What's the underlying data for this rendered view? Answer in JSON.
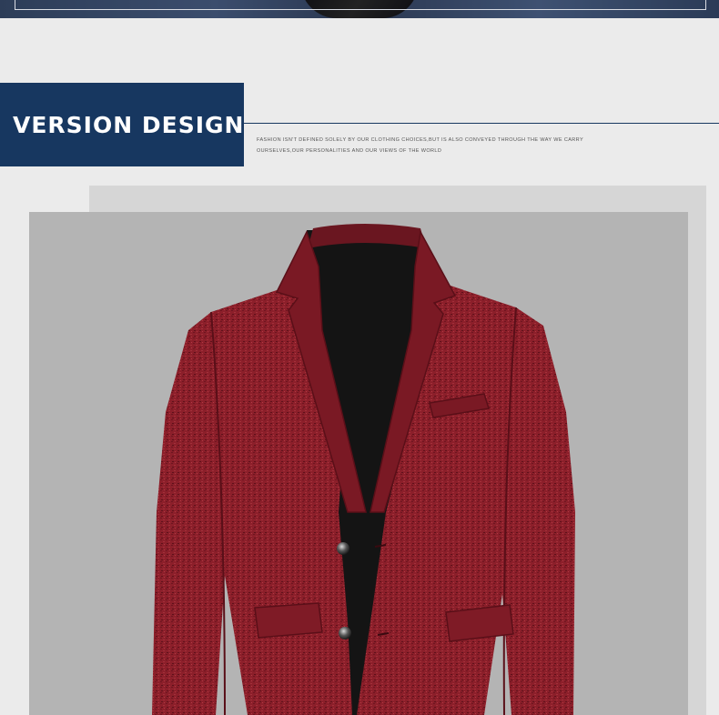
{
  "section": {
    "title": "VERSION DESIGN",
    "subtitle_line1": "FASHION ISN'T DEFINED SOLELY BY OUR CLOTHING CHOICES,BUT IS ALSO CONVEYED THROUGH THE WAY WE CARRY",
    "subtitle_line2": "OURSELVES,OUR PERSONALITIES AND OUR VIEWS OF THE WORLD"
  },
  "product": {
    "image": "burgundy-wool-blazer-photo",
    "blazer_color": "#8c1f2a",
    "background_color": "#b4b4b4"
  }
}
